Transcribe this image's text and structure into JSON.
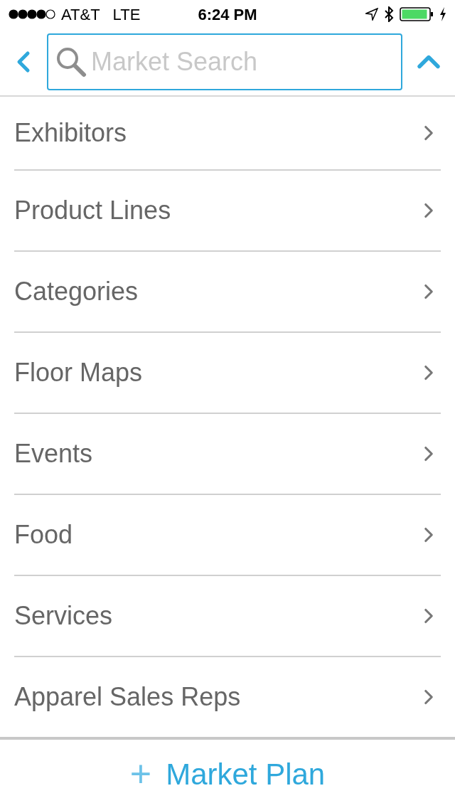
{
  "status_bar": {
    "carrier": "AT&T",
    "network": "LTE",
    "time": "6:24 PM"
  },
  "search": {
    "placeholder": "Market Search"
  },
  "menu": [
    {
      "label": "Exhibitors"
    },
    {
      "label": "Product Lines"
    },
    {
      "label": "Categories"
    },
    {
      "label": "Floor Maps"
    },
    {
      "label": "Events"
    },
    {
      "label": "Food"
    },
    {
      "label": "Services"
    },
    {
      "label": "Apparel Sales Reps"
    }
  ],
  "footer_button": {
    "icon": "+",
    "label": "Market Plan"
  }
}
